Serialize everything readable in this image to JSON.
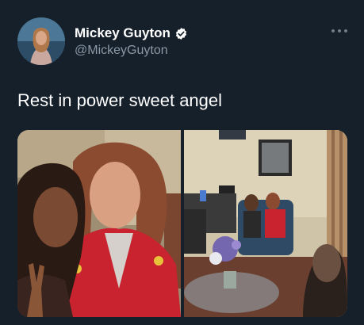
{
  "author": {
    "display_name": "Mickey Guyton",
    "handle": "@MickeyGuyton",
    "verified": true,
    "avatar_icon": "profile-avatar"
  },
  "tweet": {
    "text": "Rest in power sweet angel"
  },
  "menu": {
    "icon": "more-options-icon"
  },
  "media": {
    "count": 2,
    "photos": [
      {
        "icon": "photo-two-women-posing"
      },
      {
        "icon": "photo-backstage-room"
      }
    ]
  },
  "colors": {
    "background": "#15202b",
    "text_primary": "#ffffff",
    "text_secondary": "#8b98a5",
    "verified_badge": "#ffffff"
  }
}
